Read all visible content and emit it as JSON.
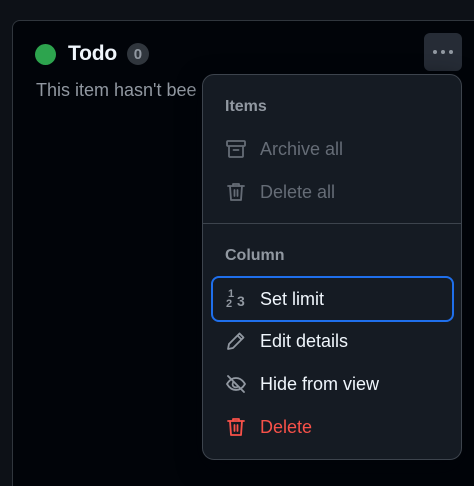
{
  "column": {
    "title": "Todo",
    "count": "0",
    "description": "This item hasn't bee",
    "status_color": "#2da44e",
    "more_icon": "kebab-horizontal-icon"
  },
  "menu": {
    "items_group_label": "Items",
    "archive_all_label": "Archive all",
    "delete_all_label": "Delete all",
    "column_group_label": "Column",
    "set_limit_label": "Set limit",
    "edit_details_label": "Edit details",
    "hide_from_view_label": "Hide from view",
    "delete_label": "Delete",
    "icons": {
      "archive_all": "archive-icon",
      "delete_all": "trash-icon",
      "set_limit": "number-icon",
      "edit_details": "pencil-icon",
      "hide_from_view": "eye-closed-icon",
      "delete": "trash-icon"
    },
    "colors": {
      "danger": "#f85149",
      "focus": "#1f6feb",
      "disabled": "#656c76"
    }
  }
}
